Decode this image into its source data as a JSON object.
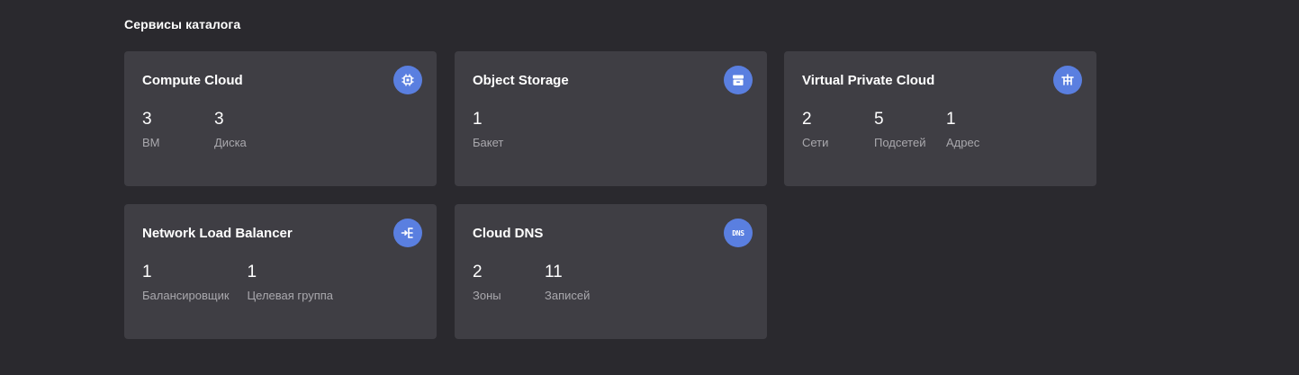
{
  "section": {
    "title": "Сервисы каталога"
  },
  "accent_color": "#5a7fe0",
  "cards": [
    {
      "title": "Compute Cloud",
      "icon": "chip-icon",
      "metrics": [
        {
          "value": "3",
          "label": "ВМ"
        },
        {
          "value": "3",
          "label": "Диска"
        }
      ]
    },
    {
      "title": "Object Storage",
      "icon": "storage-icon",
      "metrics": [
        {
          "value": "1",
          "label": "Бакет"
        }
      ]
    },
    {
      "title": "Virtual Private Cloud",
      "icon": "network-icon",
      "metrics": [
        {
          "value": "2",
          "label": "Сети"
        },
        {
          "value": "5",
          "label": "Подсетей"
        },
        {
          "value": "1",
          "label": "Адрес"
        }
      ]
    },
    {
      "title": "Network Load Balancer",
      "icon": "balancer-icon",
      "metrics": [
        {
          "value": "1",
          "label": "Балансировщик"
        },
        {
          "value": "1",
          "label": "Целевая группа"
        }
      ]
    },
    {
      "title": "Cloud DNS",
      "icon": "dns-icon",
      "icon_text": "DNS",
      "metrics": [
        {
          "value": "2",
          "label": "Зоны"
        },
        {
          "value": "11",
          "label": "Записей"
        }
      ]
    }
  ]
}
